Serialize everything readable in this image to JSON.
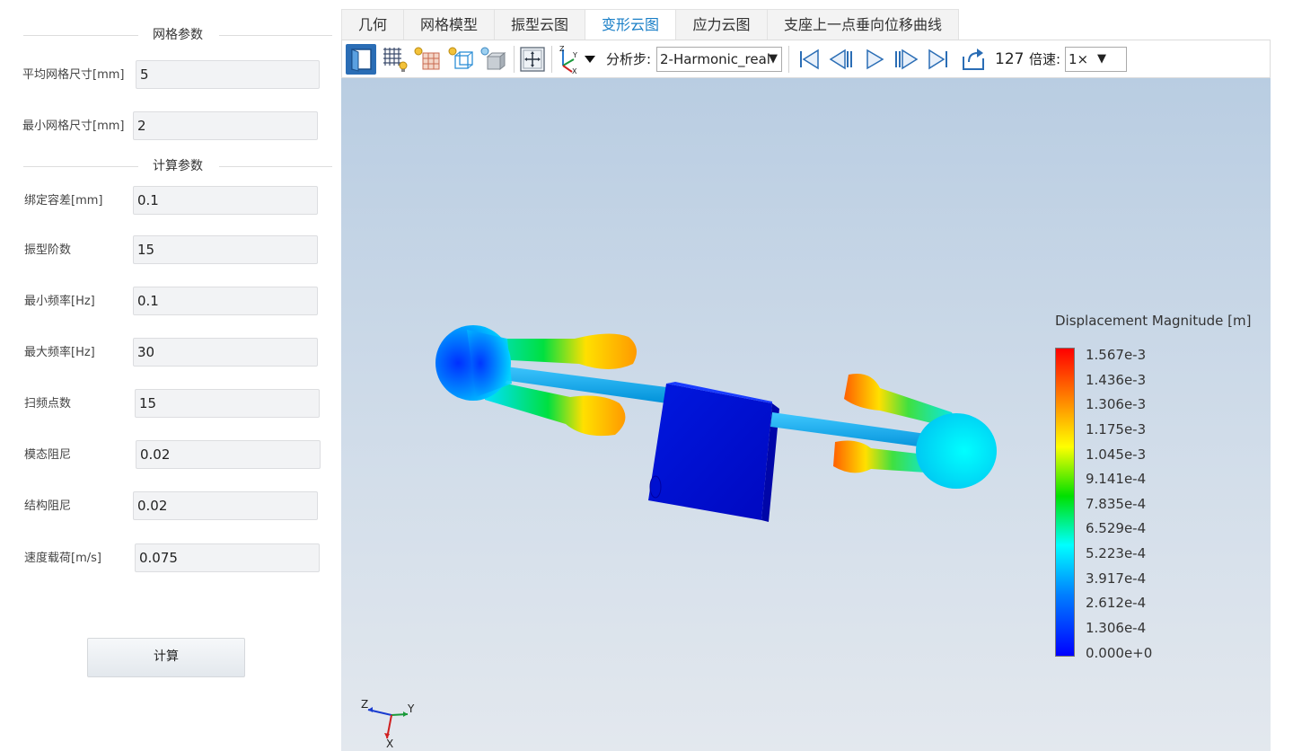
{
  "mesh_params": {
    "header": "网格参数",
    "fields": [
      {
        "label": "平均网格尺寸[mm]",
        "value": "5"
      },
      {
        "label": "最小网格尺寸[mm]",
        "value": "2"
      }
    ]
  },
  "calc_params": {
    "header": "计算参数",
    "fields": [
      {
        "label": "绑定容差[mm]",
        "value": "0.1"
      },
      {
        "label": "振型阶数",
        "value": "15"
      },
      {
        "label": "最小频率[Hz]",
        "value": "0.1"
      },
      {
        "label": "最大频率[Hz]",
        "value": "30"
      },
      {
        "label": "扫频点数",
        "value": "15"
      },
      {
        "label": "模态阻尼",
        "value": "0.02"
      },
      {
        "label": "结构阻尼",
        "value": "0.02"
      },
      {
        "label": "速度载荷[m/s]",
        "value": "0.075"
      }
    ]
  },
  "calc_button": "计算",
  "tabs": [
    {
      "label": "几何",
      "active": false
    },
    {
      "label": "网格模型",
      "active": false
    },
    {
      "label": "振型云图",
      "active": false
    },
    {
      "label": "变形云图",
      "active": true
    },
    {
      "label": "应力云图",
      "active": false
    },
    {
      "label": "支座上一点垂向位移曲线",
      "active": false
    }
  ],
  "toolbar": {
    "icons": [
      "surface-view-icon",
      "mesh-view-icon",
      "mesh-light-icon",
      "wireframe-light-icon",
      "solid-light-icon",
      "fit-view-icon",
      "axis-orientation-icon"
    ],
    "step_label": "分析步:",
    "step_value": "2-Harmonic_real",
    "frame": "127",
    "speed_label": "倍速:",
    "speed_value": "1×",
    "playback": [
      "first-frame-icon",
      "step-back-icon",
      "play-icon",
      "step-forward-icon",
      "last-frame-icon",
      "loop-icon"
    ]
  },
  "legend": {
    "title": "Displacement Magnitude [m]",
    "values": [
      "1.567e-3",
      "1.436e-3",
      "1.306e-3",
      "1.175e-3",
      "1.045e-3",
      "9.141e-4",
      "7.835e-4",
      "6.529e-4",
      "5.223e-4",
      "3.917e-4",
      "2.612e-4",
      "1.306e-4",
      "0.000e+0"
    ],
    "colors": [
      "#ff0000",
      "#ff8000",
      "#ffff00",
      "#00e000",
      "#00ffff",
      "#0080ff",
      "#0000ff"
    ]
  },
  "axes": {
    "z": "Z",
    "y": "Y",
    "x": "X"
  }
}
